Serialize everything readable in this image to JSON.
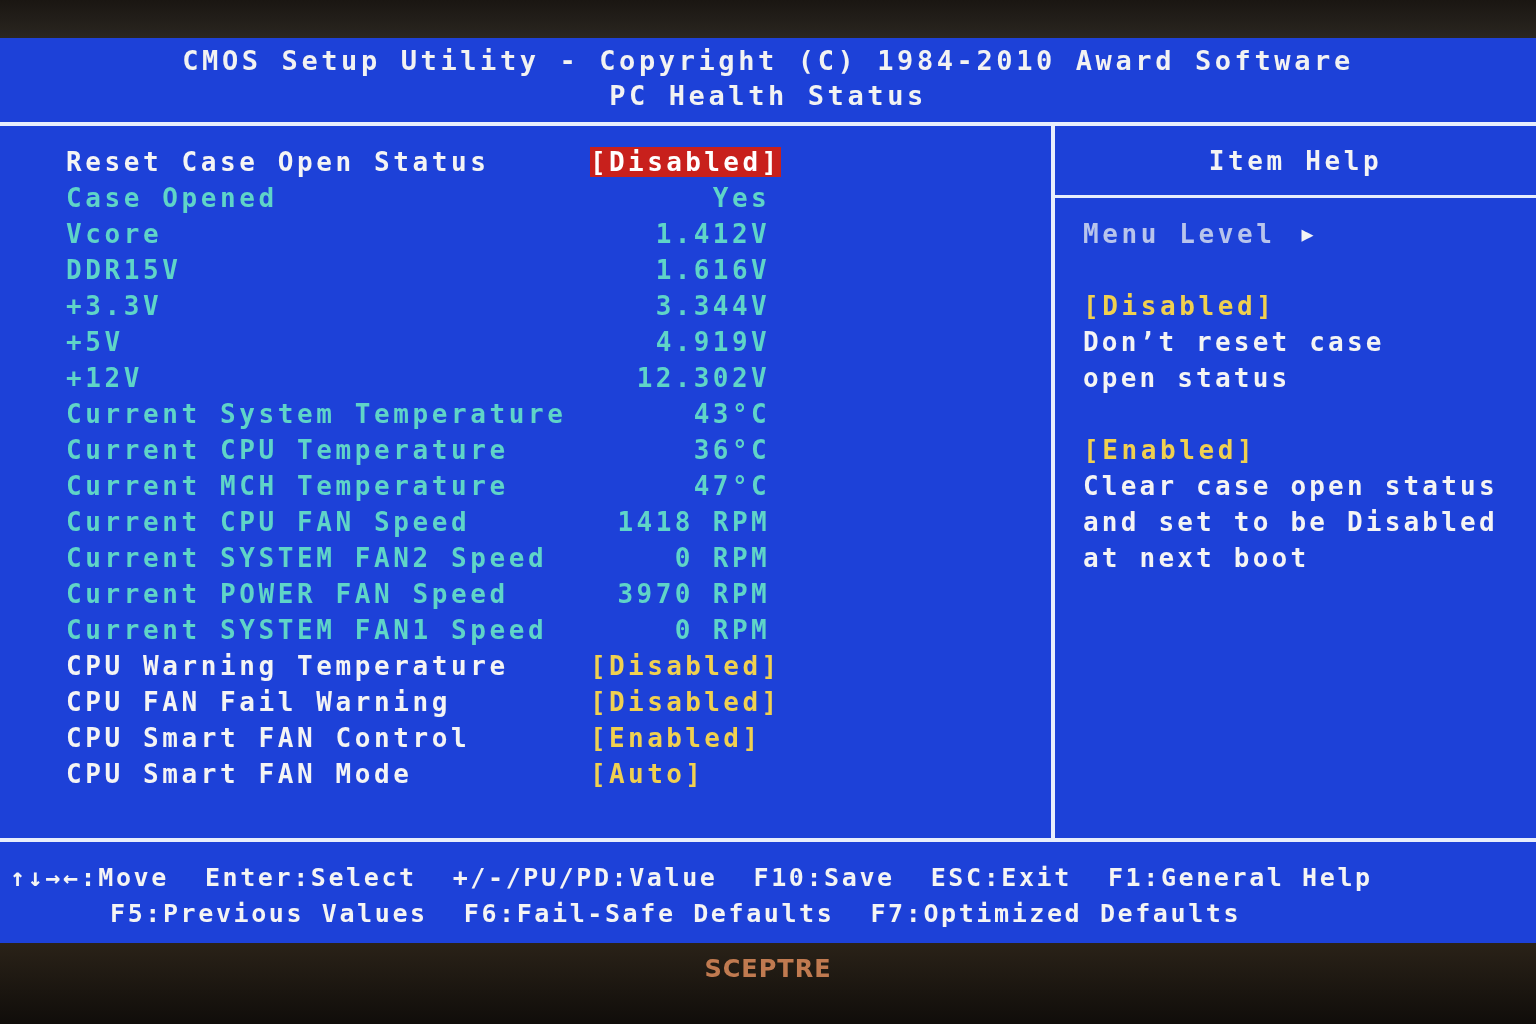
{
  "header": {
    "title": "CMOS Setup Utility - Copyright (C) 1984-2010 Award Software",
    "subtitle": "PC Health Status"
  },
  "settings": [
    {
      "kind": "setting",
      "label": "Reset Case Open Status",
      "value": "[Disabled]",
      "selected": true
    },
    {
      "kind": "reading",
      "label": "Case Opened",
      "value": "Yes"
    },
    {
      "kind": "reading",
      "label": "Vcore",
      "value": "1.412V"
    },
    {
      "kind": "reading",
      "label": "DDR15V",
      "value": "1.616V"
    },
    {
      "kind": "reading",
      "label": "+3.3V",
      "value": "3.344V"
    },
    {
      "kind": "reading",
      "label": "+5V",
      "value": "4.919V"
    },
    {
      "kind": "reading",
      "label": "+12V",
      "value": "12.302V"
    },
    {
      "kind": "reading",
      "label": "Current System Temperature",
      "value": "43°C"
    },
    {
      "kind": "reading",
      "label": "Current CPU Temperature",
      "value": "36°C"
    },
    {
      "kind": "reading",
      "label": "Current MCH Temperature",
      "value": "47°C"
    },
    {
      "kind": "reading",
      "label": "Current CPU FAN Speed",
      "value": "1418 RPM"
    },
    {
      "kind": "reading",
      "label": "Current SYSTEM FAN2 Speed",
      "value": "0 RPM"
    },
    {
      "kind": "reading",
      "label": "Current POWER FAN Speed",
      "value": "3970 RPM"
    },
    {
      "kind": "reading",
      "label": "Current SYSTEM FAN1 Speed",
      "value": "0 RPM"
    },
    {
      "kind": "setting",
      "label": "CPU Warning Temperature",
      "value": "[Disabled]",
      "selected": false
    },
    {
      "kind": "setting",
      "label": "CPU FAN Fail Warning",
      "value": "[Disabled]",
      "selected": false
    },
    {
      "kind": "setting",
      "label": "CPU Smart FAN Control",
      "value": "[Enabled]",
      "selected": false
    },
    {
      "kind": "setting",
      "label": "CPU Smart FAN Mode",
      "value": "[Auto]",
      "selected": false
    }
  ],
  "item_help": {
    "title": "Item Help",
    "menu_level": "Menu Level",
    "menu_level_marker": "▶",
    "blocks": [
      {
        "option": "[Disabled]",
        "lines": [
          "Don’t reset case",
          "open status"
        ]
      },
      {
        "option": "[Enabled]",
        "lines": [
          "Clear case open status",
          "and set to be Disabled",
          "at next boot"
        ]
      }
    ]
  },
  "key_help": [
    [
      "↑↓→←:Move",
      "Enter:Select",
      "+/-/PU/PD:Value",
      "F10:Save",
      "ESC:Exit",
      "F1:General Help"
    ],
    [
      "F5:Previous Values",
      "F6:Fail-Safe Defaults",
      "F7:Optimized Defaults"
    ]
  ],
  "monitor": {
    "brand": "SCEPTRE"
  }
}
